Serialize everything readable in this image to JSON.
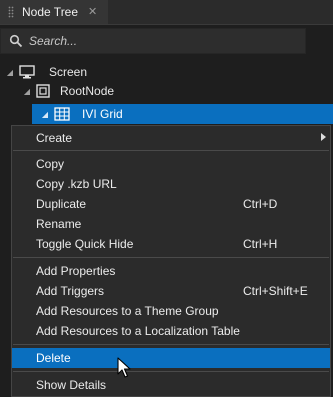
{
  "panel": {
    "tab_title": "Node Tree",
    "close_glyph": "✕"
  },
  "search": {
    "placeholder": "Search..."
  },
  "tree": [
    {
      "label": "Screen",
      "icon": "screen-icon"
    },
    {
      "label": "RootNode",
      "icon": "node-icon"
    },
    {
      "label": "IVI Grid",
      "icon": "grid-icon",
      "selected": true
    }
  ],
  "context_menu": {
    "create": "Create",
    "copy": "Copy",
    "copy_kzb_url": "Copy .kzb URL",
    "duplicate": "Duplicate",
    "duplicate_shortcut": "Ctrl+D",
    "rename": "Rename",
    "toggle_quick_hide": "Toggle Quick Hide",
    "toggle_quick_hide_shortcut": "Ctrl+H",
    "add_properties": "Add Properties",
    "add_triggers": "Add Triggers",
    "add_triggers_shortcut": "Ctrl+Shift+E",
    "add_resources_theme": "Add Resources to a Theme Group",
    "add_resources_localization": "Add Resources to a Localization Table",
    "delete": "Delete",
    "show_details": "Show Details"
  },
  "colors": {
    "selection": "#0a6fbf",
    "background": "#1e1e1e",
    "menu_background": "#2b2b2b"
  }
}
